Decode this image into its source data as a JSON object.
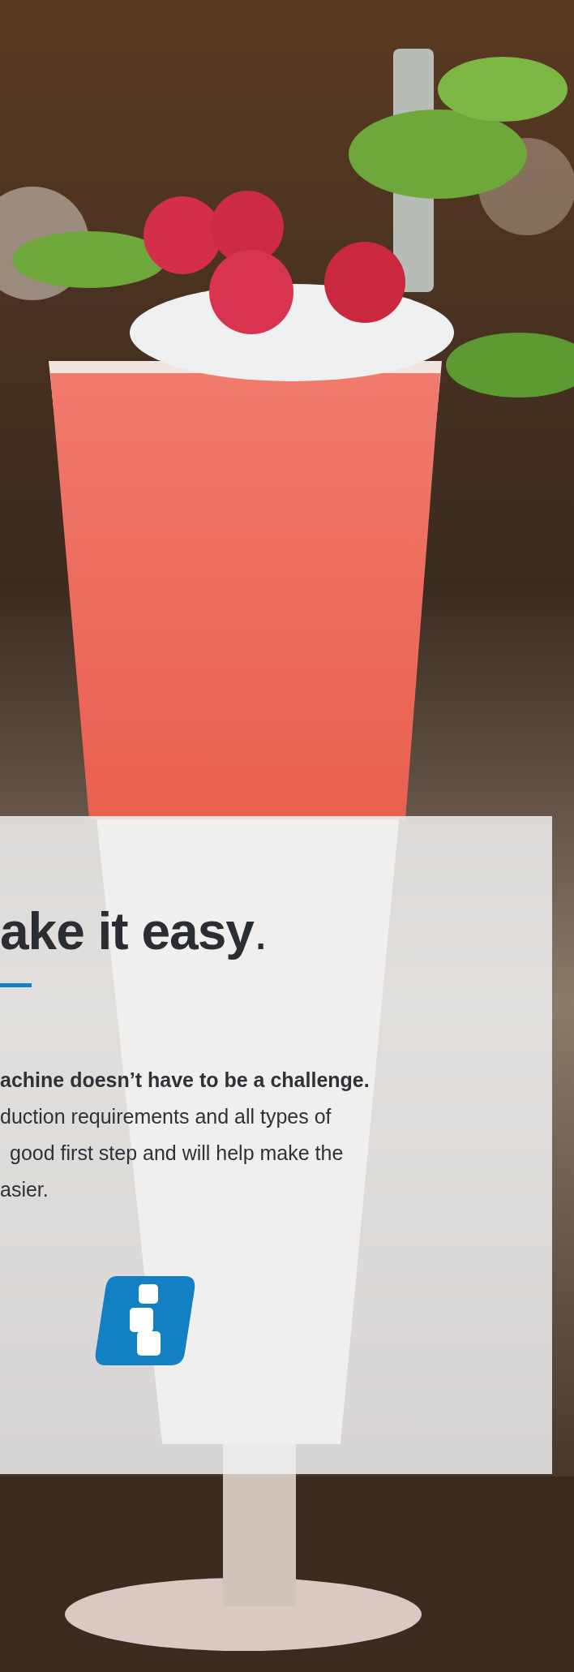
{
  "panel": {
    "title": "**ake it easy**.",
    "lines": [
      {
        "text": "achine doesn’t have to be a challenge.",
        "kind": "lead"
      },
      {
        "text": "duction requirements and all types of",
        "kind": "body"
      },
      {
        "text": "good first step and will help make the",
        "kind": "body"
      },
      {
        "text": "asier.",
        "kind": "body"
      }
    ]
  }
}
